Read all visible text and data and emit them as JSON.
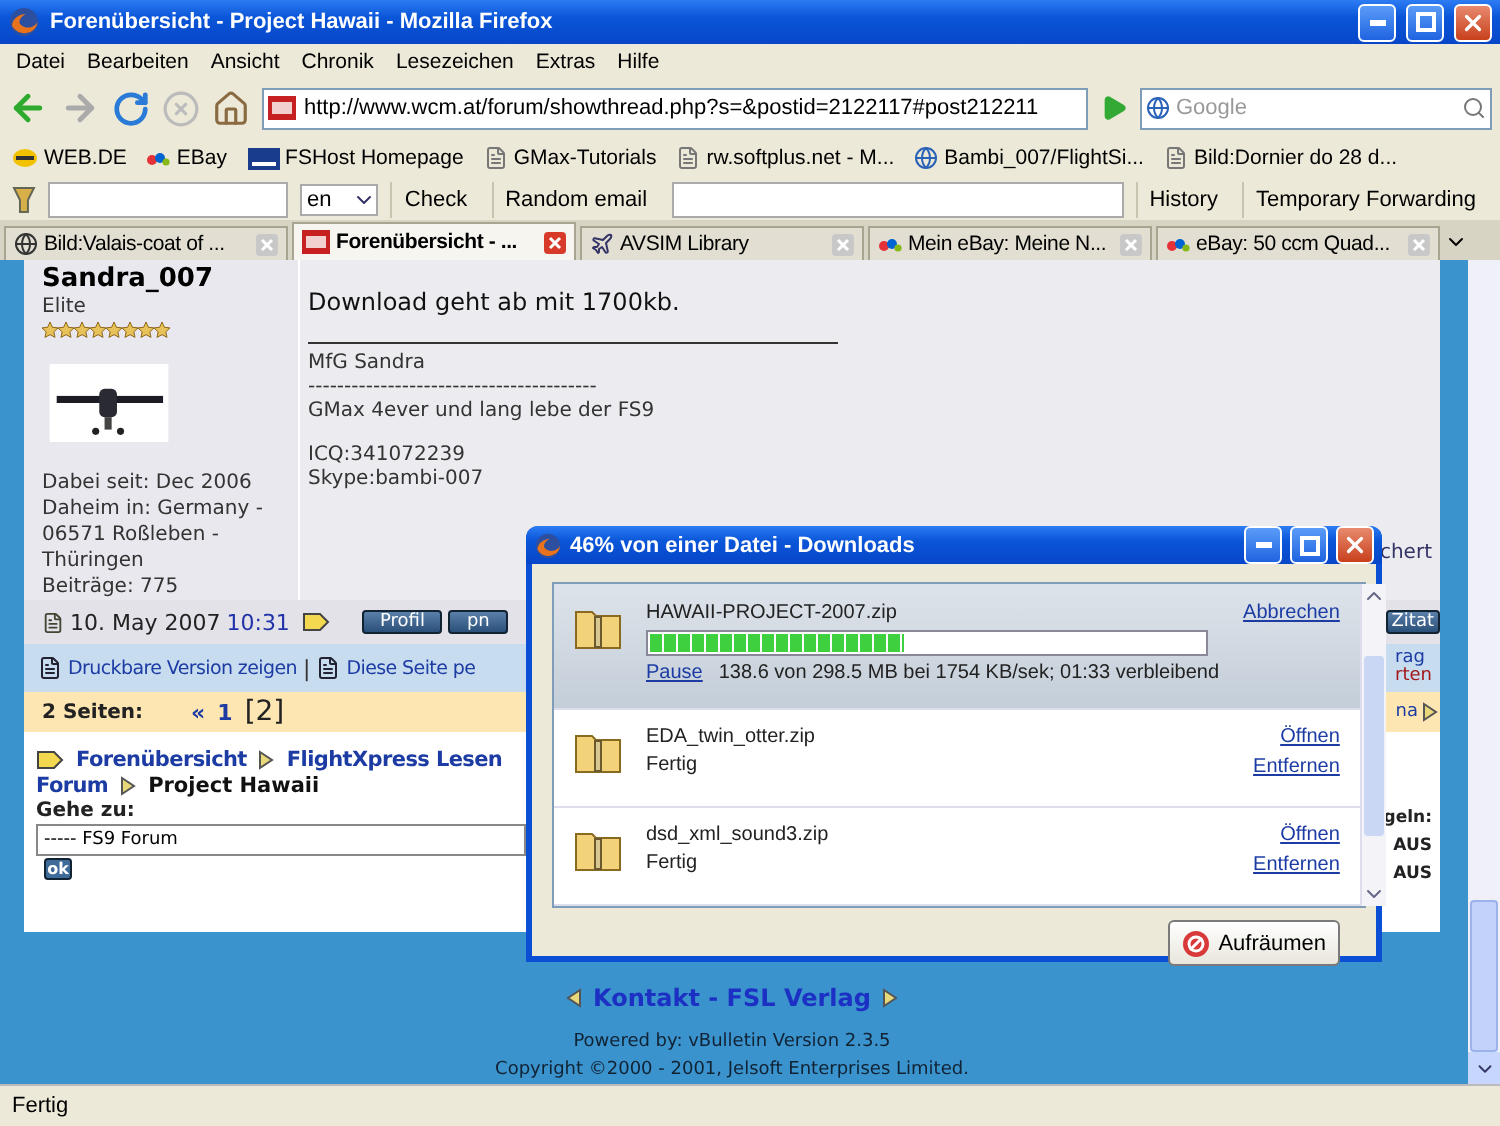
{
  "window": {
    "title": "Forenübersicht - Project Hawaii - Mozilla Firefox"
  },
  "menu": [
    "Datei",
    "Bearbeiten",
    "Ansicht",
    "Chronik",
    "Lesezeichen",
    "Extras",
    "Hilfe"
  ],
  "address": {
    "url": "http://www.wcm.at/forum/showthread.php?s=&postid=2122117#post212211",
    "search_placeholder": "Google"
  },
  "bookmarks": [
    {
      "label": "WEB.DE",
      "kind": "web"
    },
    {
      "label": "EBay",
      "kind": "ebay"
    },
    {
      "label": "FSHost Homepage",
      "kind": "fsh"
    },
    {
      "label": "GMax-Tutorials",
      "kind": "page"
    },
    {
      "label": "rw.softplus.net - M...",
      "kind": "page"
    },
    {
      "label": "Bambi_007/FlightSi...",
      "kind": "globe"
    },
    {
      "label": "Bild:Dornier do 28 d...",
      "kind": "page"
    }
  ],
  "toolbar": {
    "language": "en",
    "buttons": [
      "Check",
      "Random email"
    ],
    "right_buttons": [
      "History",
      "Temporary Forwarding"
    ]
  },
  "tabs": [
    {
      "label": "Bild:Valais-coat of ...",
      "kind": "wiki",
      "selected": false
    },
    {
      "label": "Forenübersicht - ...",
      "kind": "wcm",
      "selected": true
    },
    {
      "label": "AVSIM Library",
      "kind": "avsim",
      "selected": false
    },
    {
      "label": "Mein eBay: Meine N...",
      "kind": "ebay",
      "selected": false
    },
    {
      "label": "eBay: 50 ccm Quad...",
      "kind": "ebay",
      "selected": false
    }
  ],
  "post": {
    "author": "Sandra_007",
    "rank": "Elite",
    "stars": 8,
    "info": [
      "Dabei seit: Dec 2006",
      "Daheim in: Germany -",
      "06571 Roßleben -",
      "Thüringen",
      "Beiträge: 775"
    ],
    "message": "Download geht ab mit 1700kb.",
    "signature": [
      "MfG Sandra",
      "----------------------------------------",
      "GMax 4ever und lang lebe der FS9",
      "ICQ:341072239",
      "Skype:bambi-007"
    ],
    "edge_text": "chert",
    "date": "10. May 2007",
    "time": "10:31",
    "buttons": [
      "Profil",
      "pn"
    ],
    "edge_button": "Zitat"
  },
  "links": {
    "print": "Druckbare Version zeigen",
    "separator": "|",
    "send": "Diese Seite pe",
    "edge": [
      "rag",
      "rten"
    ]
  },
  "pages": {
    "label": "2 Seiten:",
    "first": "«",
    "items": [
      {
        "label": "1",
        "selected": false
      },
      {
        "label": "[2]",
        "selected": true
      }
    ],
    "edge": "na"
  },
  "breadcrumb": {
    "items": [
      "Forenübersicht",
      "FlightXpress Lesen"
    ],
    "forum": "Forum",
    "current": "Project Hawaii"
  },
  "jump": {
    "label": "Gehe zu:",
    "value": "----- FS9 Forum",
    "button": "ok",
    "edge": [
      "geln:",
      "AUS",
      "AUS"
    ]
  },
  "footer": {
    "link": "Kontakt - FSL Verlag",
    "powered": "Powered by: vBulletin Version 2.3.5",
    "copyright": "Copyright ©2000 - 2001, Jelsoft Enterprises Limited."
  },
  "downloads": {
    "title": "46% von einer Datei - Downloads",
    "items": [
      {
        "name": "HAWAII-PROJECT-2007.zip",
        "kind": "active",
        "selected": true,
        "level": 0.46,
        "pause": "Pause",
        "status": "138.6 von 298.5 MB bei 1754 KB/sek; 01:33 verbleibend",
        "actions": [
          "Abbrechen"
        ]
      },
      {
        "name": "EDA_twin_otter.zip",
        "kind": "done",
        "selected": false,
        "status": "Fertig",
        "actions": [
          "Öffnen",
          "Entfernen"
        ]
      },
      {
        "name": "dsd_xml_sound3.zip",
        "kind": "done",
        "selected": false,
        "status": "Fertig",
        "actions": [
          "Öffnen",
          "Entfernen"
        ]
      }
    ],
    "clear_button": "Aufräumen"
  },
  "status_bar": "Fertig"
}
